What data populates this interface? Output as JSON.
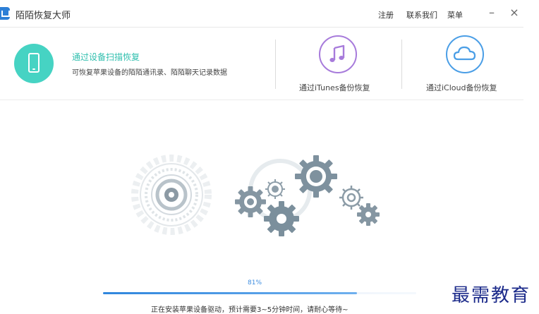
{
  "app": {
    "title": "陌陌恢复大师",
    "logo_icon": "momo-logo-icon"
  },
  "titlebar": {
    "register_label": "注册",
    "contact_label": "联系我们",
    "menu_label": "菜单",
    "minimize_glyph": "–",
    "close_glyph": "×"
  },
  "modes": {
    "device_scan": {
      "title": "通过设备扫描恢复",
      "description": "可恢复苹果设备的陌陌通讯录、陌陌聊天记录数据",
      "icon": "phone-icon",
      "color": "#46d3c3"
    },
    "itunes": {
      "label": "通过iTunes备份恢复",
      "icon": "music-note-icon",
      "color": "#a77bdb"
    },
    "icloud": {
      "label": "通过iCloud备份恢复",
      "icon": "cloud-icon",
      "color": "#4a9ee6"
    }
  },
  "progress": {
    "percent_label": "81%",
    "percent": 81,
    "status": "正在安装苹果设备驱动，预计需要3~5分钟时间，请耐心等待~"
  },
  "watermark": {
    "text": "最需教育"
  }
}
